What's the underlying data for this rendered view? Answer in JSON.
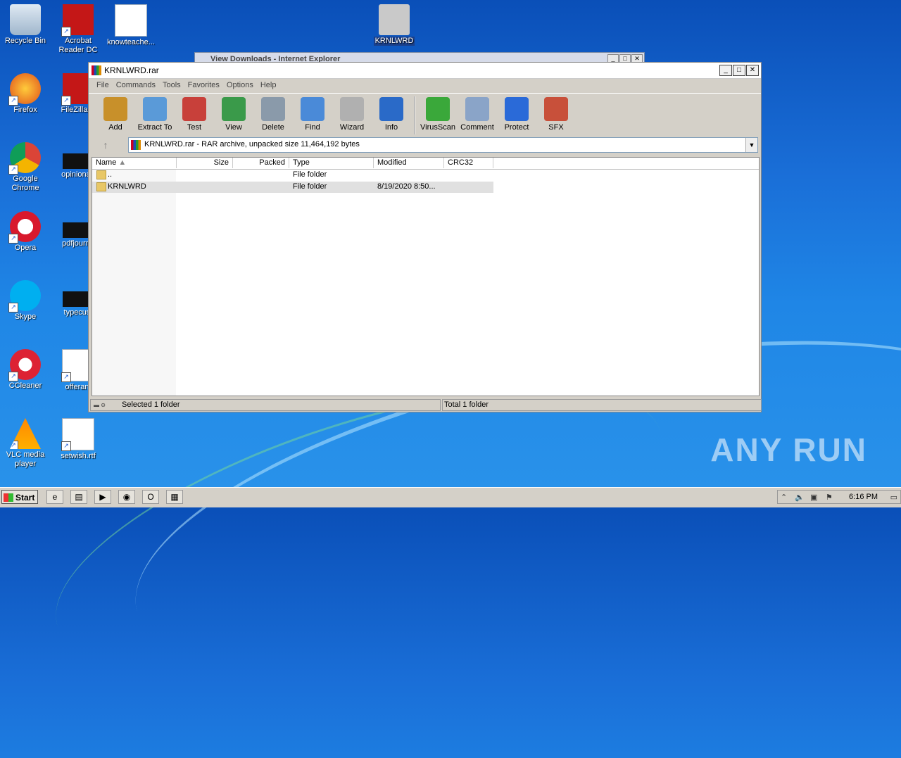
{
  "desktop": {
    "icons": [
      {
        "label": "Recycle Bin",
        "icon": "recycle-bin-icon"
      },
      {
        "label": "Acrobat\nReader DC",
        "icon": "acrobat-icon"
      },
      {
        "label": "knowteache...",
        "icon": "word-doc-icon"
      },
      {
        "label": "KRNLWRD",
        "icon": "folder-icon"
      },
      {
        "label": "Firefox",
        "icon": "firefox-icon"
      },
      {
        "label": "FileZilla C",
        "icon": "filezilla-icon"
      },
      {
        "label": "Google\nChrome",
        "icon": "chrome-icon"
      },
      {
        "label": "opinionau",
        "icon": "file-icon"
      },
      {
        "label": "Opera",
        "icon": "opera-icon"
      },
      {
        "label": "pdfjourna",
        "icon": "file-icon"
      },
      {
        "label": "Skype",
        "icon": "skype-icon"
      },
      {
        "label": "typecust",
        "icon": "file-icon"
      },
      {
        "label": "CCleaner",
        "icon": "ccleaner-icon"
      },
      {
        "label": "offerant",
        "icon": "word-doc-icon"
      },
      {
        "label": "VLC media\nplayer",
        "icon": "vlc-icon"
      },
      {
        "label": "setwish.rtf",
        "icon": "word-doc-icon"
      }
    ],
    "watermark": "ANY RUN"
  },
  "ie_window": {
    "title": "View Downloads - Internet Explorer"
  },
  "winrar": {
    "title": "KRNLWRD.rar",
    "menu": [
      "File",
      "Commands",
      "Tools",
      "Favorites",
      "Options",
      "Help"
    ],
    "toolbar": [
      {
        "label": "Add",
        "icon": "add-archive-icon",
        "color": "#c8902a"
      },
      {
        "label": "Extract To",
        "icon": "extract-folder-icon",
        "color": "#5a9ad8"
      },
      {
        "label": "Test",
        "icon": "test-clipboard-icon",
        "color": "#c8403a"
      },
      {
        "label": "View",
        "icon": "view-book-icon",
        "color": "#3a9a4a"
      },
      {
        "label": "Delete",
        "icon": "delete-trash-icon",
        "color": "#8a9aaa"
      },
      {
        "label": "Find",
        "icon": "find-magnifier-icon",
        "color": "#4a8ad8"
      },
      {
        "label": "Wizard",
        "icon": "wizard-wand-icon",
        "color": "#b0b0b0"
      },
      {
        "label": "Info",
        "icon": "info-icon",
        "color": "#2a6ac8"
      }
    ],
    "toolbar2": [
      {
        "label": "VirusScan",
        "icon": "virusscan-icon",
        "color": "#3aa83a"
      },
      {
        "label": "Comment",
        "icon": "comment-icon",
        "color": "#8aa4c8"
      },
      {
        "label": "Protect",
        "icon": "protect-shield-icon",
        "color": "#2a6ad8"
      },
      {
        "label": "SFX",
        "icon": "sfx-icon",
        "color": "#c8503a"
      }
    ],
    "address": "KRNLWRD.rar - RAR archive, unpacked size 11,464,192 bytes",
    "columns": [
      "Name",
      "Size",
      "Packed",
      "Type",
      "Modified",
      "CRC32"
    ],
    "rows": [
      {
        "name": "..",
        "size": "",
        "packed": "",
        "type": "File folder",
        "modified": "",
        "crc": ""
      },
      {
        "name": "KRNLWRD",
        "size": "",
        "packed": "",
        "type": "File folder",
        "modified": "8/19/2020 8:50...",
        "crc": ""
      }
    ],
    "status_left": "Selected 1 folder",
    "status_right": "Total 1 folder"
  },
  "taskbar": {
    "start_label": "Start",
    "apps": [
      {
        "icon": "internet-explorer-icon",
        "glyph": "e"
      },
      {
        "icon": "explorer-folder-icon",
        "glyph": "▤"
      },
      {
        "icon": "media-player-icon",
        "glyph": "▶"
      },
      {
        "icon": "chrome-icon",
        "glyph": "◉"
      },
      {
        "icon": "opera-icon",
        "glyph": "O"
      },
      {
        "icon": "winrar-icon",
        "glyph": "▦"
      }
    ],
    "clock": "6:16 PM"
  }
}
